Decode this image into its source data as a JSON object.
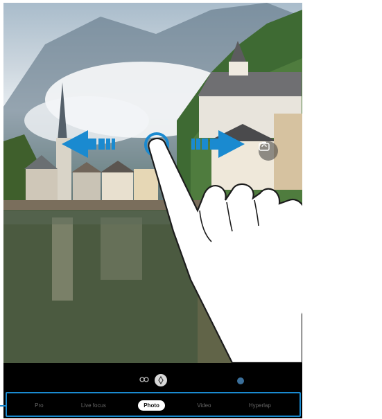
{
  "camera": {
    "modes": [
      "Pro",
      "Live focus",
      "Photo",
      "Video",
      "Hyperlap"
    ],
    "active_mode": "Photo",
    "lens_icon_left": "lens-switch-icon",
    "lens_icon_right": "wide-lens-icon",
    "switch_camera_icon": "switch-camera-icon"
  },
  "annotation": {
    "gesture": "swipe-left-right",
    "arrow_color": "#1a8ad0",
    "highlight_color": "#1a8ad0"
  }
}
